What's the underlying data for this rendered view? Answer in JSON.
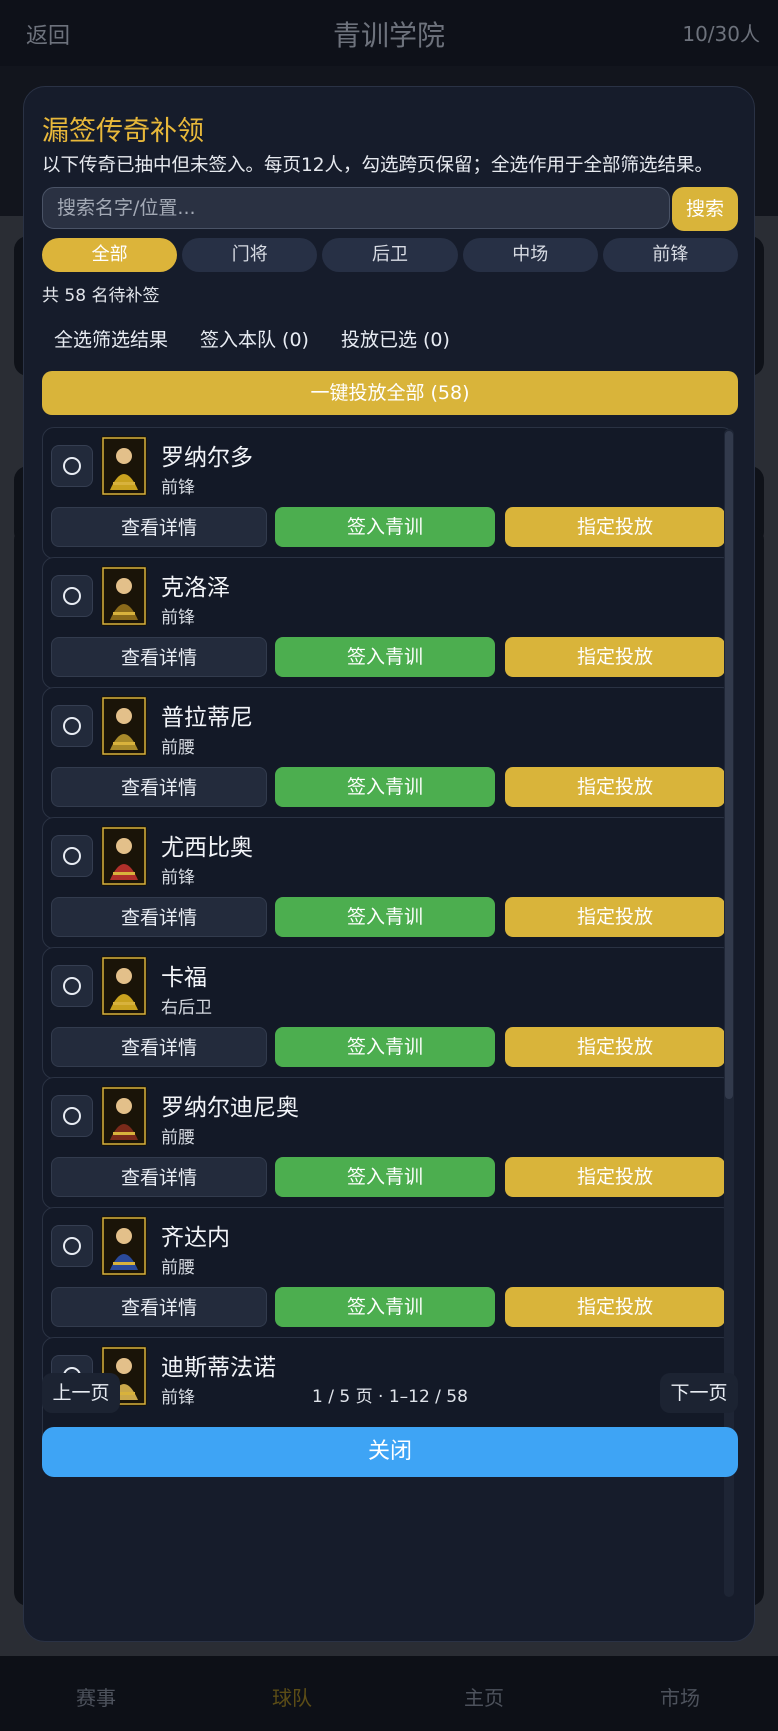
{
  "app": {
    "back": "返回",
    "title": "青训学院",
    "count": "10/30人"
  },
  "bottom_nav": [
    "赛事",
    "球队",
    "主页",
    "市场"
  ],
  "modal": {
    "title": "漏签传奇补领",
    "description": "以下传奇已抽中但未签入。每页12人，勾选跨页保留；全选作用于全部筛选结果。",
    "search_placeholder": "搜索名字/位置...",
    "search_button": "搜索",
    "filters": [
      "全部",
      "门将",
      "后卫",
      "中场",
      "前锋"
    ],
    "active_filter": "全部",
    "total": "共 58 名待补签",
    "select_all": "全选筛选结果",
    "sign_selected": "签入本队 (0)",
    "release_selected": "投放已选 (0)",
    "release_all": "一键投放全部 (58)",
    "buttons": {
      "detail": "查看详情",
      "sign": "签入青训",
      "assign": "指定投放"
    },
    "players": [
      {
        "name": "罗纳尔多",
        "position": "前锋"
      },
      {
        "name": "克洛泽",
        "position": "前锋"
      },
      {
        "name": "普拉蒂尼",
        "position": "前腰"
      },
      {
        "name": "尤西比奥",
        "position": "前锋"
      },
      {
        "name": "卡福",
        "position": "右后卫"
      },
      {
        "name": "罗纳尔迪尼奥",
        "position": "前腰"
      },
      {
        "name": "齐达内",
        "position": "前腰"
      },
      {
        "name": "迪斯蒂法诺",
        "position": "前锋"
      }
    ],
    "pager": {
      "prev": "上一页",
      "info": "1 / 5 页 · 1–12 / 58",
      "next": "下一页"
    },
    "close": "关闭"
  },
  "colors": {
    "accent": "#d9b43a",
    "sign": "#4cae4f",
    "close": "#3ea4f5"
  }
}
